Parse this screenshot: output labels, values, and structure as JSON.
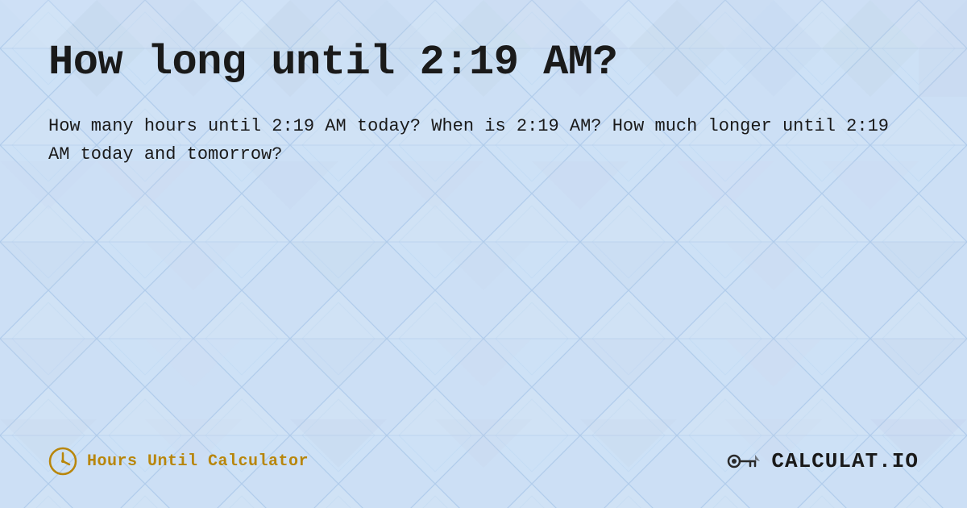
{
  "page": {
    "title": "How long until 2:19 AM?",
    "description": "How many hours until 2:19 AM today? When is 2:19 AM? How much longer until 2:19 AM today and tomorrow?",
    "footer": {
      "left_label": "Hours Until Calculator",
      "right_label": "CALCULAT.IO"
    },
    "colors": {
      "background": "#c8dff5",
      "title": "#1a1a1a",
      "description": "#1a1a1a",
      "footer_left": "#b8860b",
      "footer_right": "#1a1a1a"
    }
  }
}
